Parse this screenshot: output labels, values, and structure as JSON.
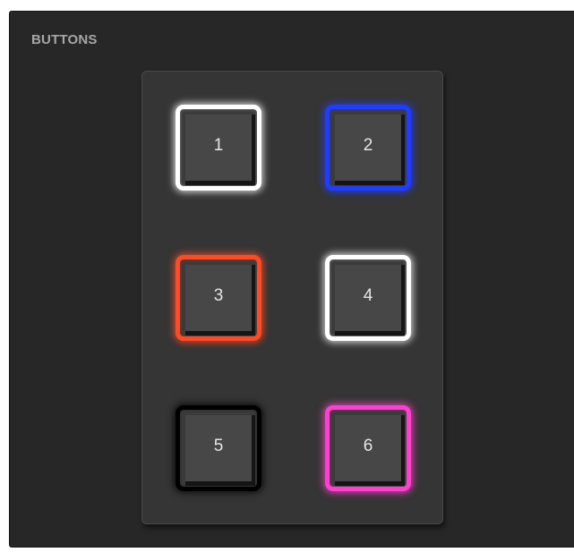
{
  "panel": {
    "title": "BUTTONS"
  },
  "buttons": [
    {
      "label": "1",
      "glow_color": "#ffffff"
    },
    {
      "label": "2",
      "glow_color": "#1f3cff"
    },
    {
      "label": "3",
      "glow_color": "#ff4a26"
    },
    {
      "label": "4",
      "glow_color": "#ffffff"
    },
    {
      "label": "5",
      "glow_color": "#000000"
    },
    {
      "label": "6",
      "glow_color": "#ff3fcf"
    }
  ],
  "colors": {
    "panel_bg": "#272727",
    "pad_bg": "#353535",
    "key_cap": "#474747",
    "title_text": "#a6a6a6",
    "key_text": "#e6e6e6"
  }
}
